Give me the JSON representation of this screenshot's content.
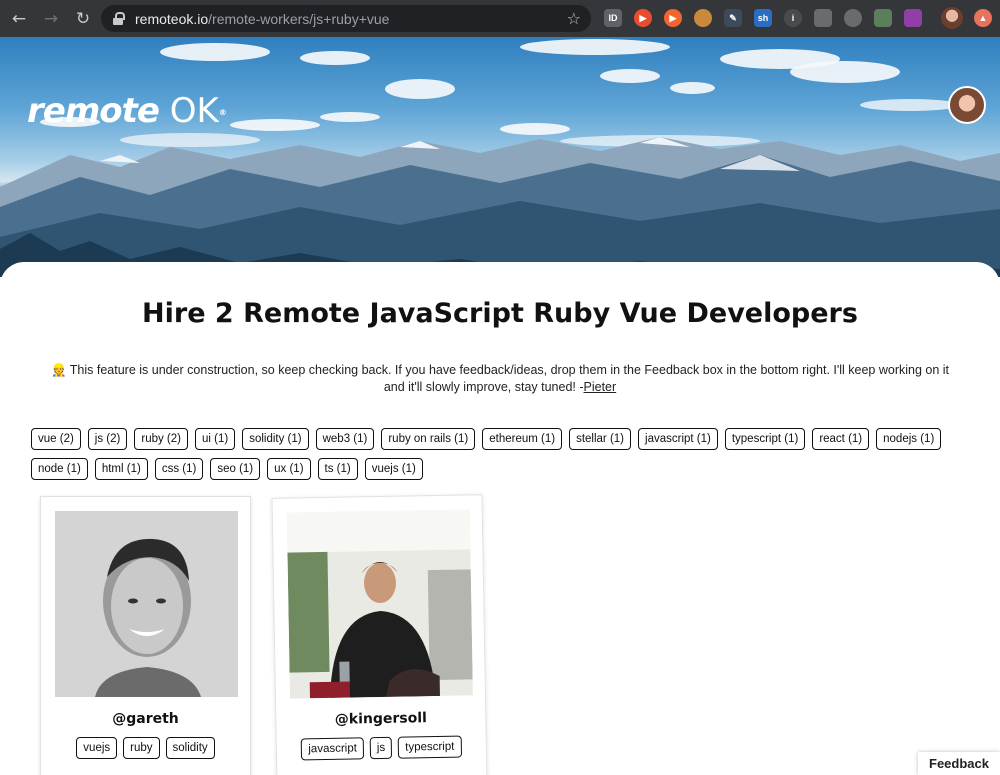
{
  "browser": {
    "url_host": "remoteok.io",
    "url_path": "/remote-workers/js+ruby+vue"
  },
  "header": {
    "logo_text": "remote",
    "logo_ok": "OK",
    "logo_reg": "®"
  },
  "page": {
    "title": "Hire 2 Remote JavaScript Ruby Vue Developers",
    "notice_emoji": "👷",
    "notice_text": "This feature is under construction, so keep checking back. If you have feedback/ideas, drop them in the Feedback box in the bottom right. I'll keep working on it and it'll slowly improve, stay tuned! -",
    "notice_link": "Pieter"
  },
  "tags": [
    "vue (2)",
    "js (2)",
    "ruby (2)",
    "ui (1)",
    "solidity (1)",
    "web3 (1)",
    "ruby on rails (1)",
    "ethereum (1)",
    "stellar (1)",
    "javascript (1)",
    "typescript (1)",
    "react (1)",
    "nodejs (1)",
    "node (1)",
    "html (1)",
    "css (1)",
    "seo (1)",
    "ux (1)",
    "ts (1)",
    "vuejs (1)"
  ],
  "developers": [
    {
      "handle": "@gareth",
      "tags": [
        "vuejs",
        "ruby",
        "solidity"
      ]
    },
    {
      "handle": "@kingersoll",
      "tags": [
        "javascript",
        "js",
        "typescript"
      ]
    }
  ],
  "feedback_label": "Feedback",
  "icons": [
    "back-arrow-icon",
    "forward-arrow-icon",
    "reload-icon",
    "lock-icon",
    "star-icon"
  ]
}
